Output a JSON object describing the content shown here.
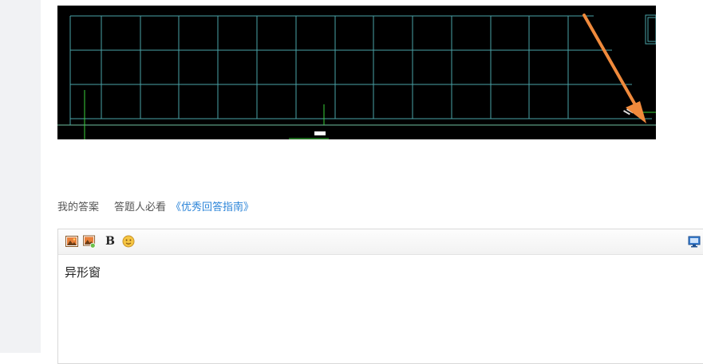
{
  "answer_bar": {
    "my_answer": "我的答案",
    "must_read": "答题人必看",
    "guide_link": "《优秀回答指南》"
  },
  "editor": {
    "content": "异形窗",
    "toolbar": {
      "bold_label": "B",
      "icons": [
        "insert-image-icon",
        "upload-image-icon",
        "bold-icon",
        "emoji-icon",
        "fullscreen-icon"
      ]
    }
  },
  "image": {
    "background": "#000000",
    "arrow_color": "#f08a3c",
    "grid_color": "#4aa3a8"
  }
}
